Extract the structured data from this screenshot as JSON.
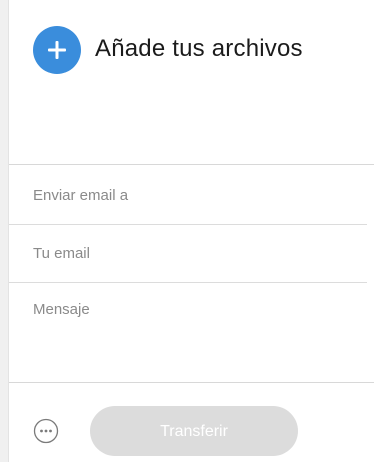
{
  "upload": {
    "title": "Añade tus archivos",
    "add_icon": "plus-icon",
    "accent_color": "#3a8ddc"
  },
  "form": {
    "email_to_placeholder": "Enviar email a",
    "email_to_value": "",
    "your_email_placeholder": "Tu email",
    "your_email_value": "",
    "message_placeholder": "Mensaje",
    "message_value": ""
  },
  "footer": {
    "more_icon": "more-options-icon",
    "transfer_label": "Transferir"
  }
}
